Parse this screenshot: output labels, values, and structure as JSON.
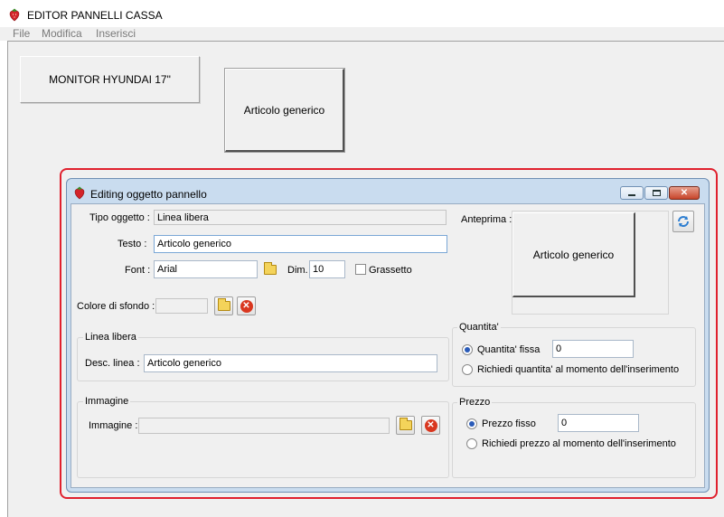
{
  "window": {
    "title": "EDITOR PANNELLI CASSA",
    "menu": [
      "File",
      "Modifica",
      "Inserisci"
    ]
  },
  "panel_buttons": {
    "monitor": "MONITOR HYUNDAI 17\"",
    "articolo": "Articolo generico"
  },
  "dialog": {
    "title": "Editing oggetto pannello",
    "tipo_oggetto": {
      "label": "Tipo oggetto :",
      "value": "Linea libera"
    },
    "testo": {
      "label": "Testo :",
      "value": "Articolo generico"
    },
    "font": {
      "label": "Font :",
      "value": "Arial"
    },
    "dim": {
      "label": "Dim.",
      "value": "10"
    },
    "grassetto": {
      "label": "Grassetto",
      "checked": false
    },
    "colore_sfondo": {
      "label": "Colore di sfondo :"
    },
    "anteprima": {
      "label": "Anteprima :",
      "preview_text": "Articolo generico"
    },
    "linea_libera": {
      "title": "Linea libera",
      "desc_label": "Desc. linea :",
      "desc_value": "Articolo generico"
    },
    "immagine": {
      "title": "Immagine",
      "label": "Immagine :",
      "value": ""
    },
    "quantita": {
      "title": "Quantita'",
      "fissa_label": "Quantita' fissa",
      "fissa_value": "0",
      "richiedi_label": "Richiedi quantita' al momento dell'inserimento",
      "selected": "fissa"
    },
    "prezzo": {
      "title": "Prezzo",
      "fisso_label": "Prezzo fisso",
      "fisso_value": "0",
      "richiedi_label": "Richiedi prezzo al momento dell'inserimento",
      "selected": "fisso"
    }
  },
  "colors": {
    "highlight": "#e0212e",
    "dialog_frame": "#c9dcef",
    "radio_selected": "#2a5bb8"
  },
  "icons": [
    "strawberry-app-icon",
    "folder-icon",
    "delete-icon",
    "refresh-icon",
    "minimize-icon",
    "maximize-icon",
    "close-icon"
  ]
}
